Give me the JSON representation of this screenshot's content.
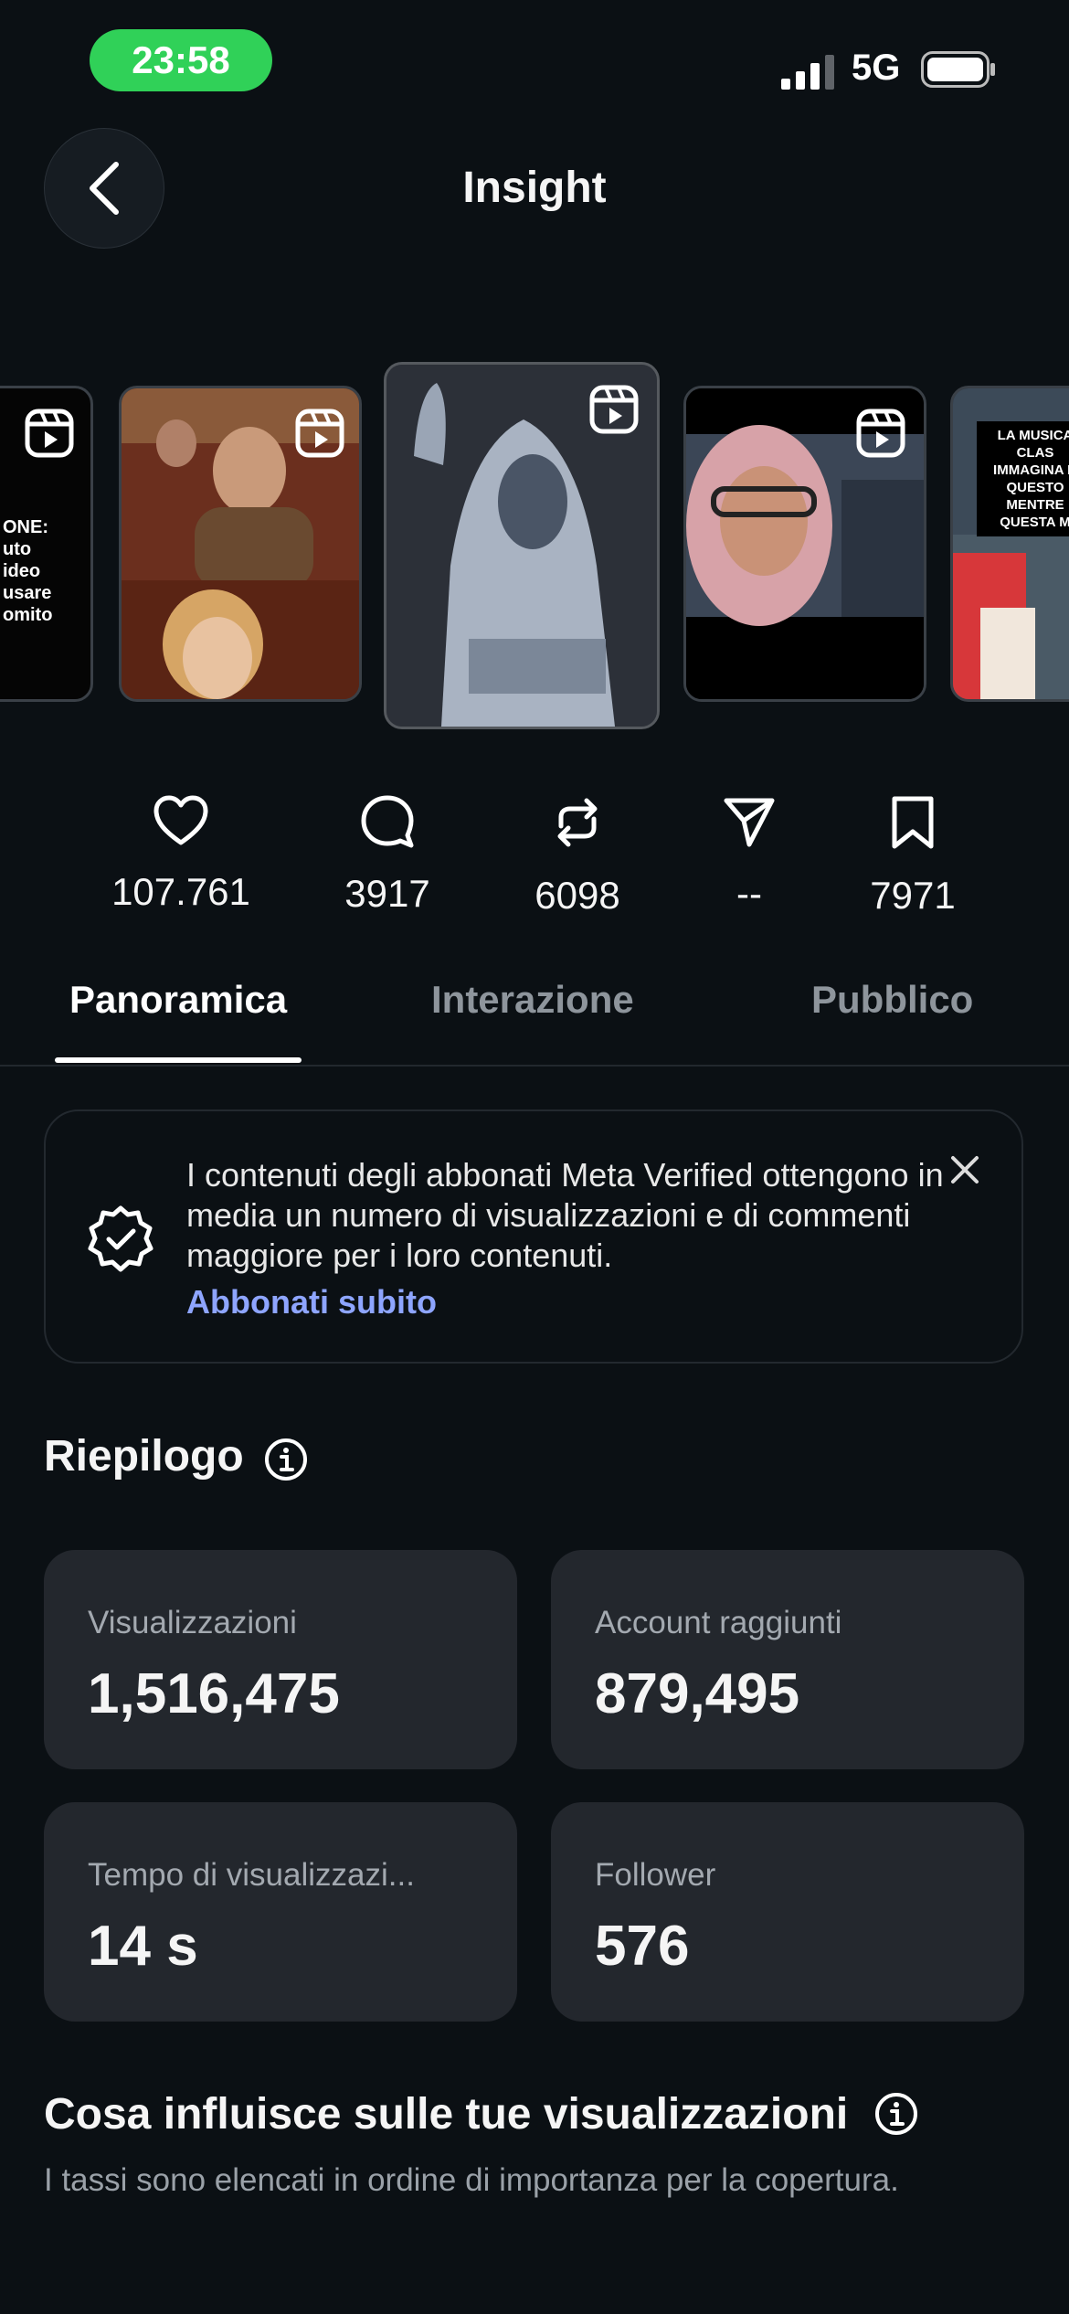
{
  "status_bar": {
    "time": "23:58",
    "network": "5G"
  },
  "header": {
    "title": "Insight"
  },
  "carousel": [
    {
      "name": "reel-thumb-1",
      "text": "ONE:\nuto\nideo\nusare\nomito"
    },
    {
      "name": "reel-thumb-2",
      "text": ""
    },
    {
      "name": "reel-thumb-3",
      "text": ""
    },
    {
      "name": "reel-thumb-4",
      "text": ""
    },
    {
      "name": "reel-thumb-5",
      "text": "LA MUSICA CLAS\nIMMAGINA D\nQUESTO\nMENTRE\nQUESTA M"
    }
  ],
  "stats": {
    "likes": "107.761",
    "comments": "3917",
    "reposts": "6098",
    "shares": "--",
    "saves": "7971"
  },
  "tabs": [
    {
      "label": "Panoramica",
      "active": true
    },
    {
      "label": "Interazione",
      "active": false
    },
    {
      "label": "Pubblico",
      "active": false
    }
  ],
  "banner": {
    "text": "I contenuti degli abbonati Meta Verified ottengono in media un numero di visualizzazioni e di commenti maggiore per i loro contenuti.",
    "link": "Abbonati subito"
  },
  "summary": {
    "title": "Riepilogo",
    "cards": [
      {
        "label": "Visualizzazioni",
        "value": "1,516,475"
      },
      {
        "label": "Account raggiunti",
        "value": "879,495"
      },
      {
        "label": "Tempo di visualizzazi...",
        "value": "14 s"
      },
      {
        "label": "Follower",
        "value": "576"
      }
    ]
  },
  "influence": {
    "title": "Cosa influisce sulle tue visualizzazioni",
    "subtitle": "I tassi sono elencati in ordine di importanza per la copertura."
  },
  "colors": {
    "accent_link": "#8ea5ff",
    "time_pill": "#30d158",
    "background": "#0b1014",
    "card": "#23272d"
  }
}
